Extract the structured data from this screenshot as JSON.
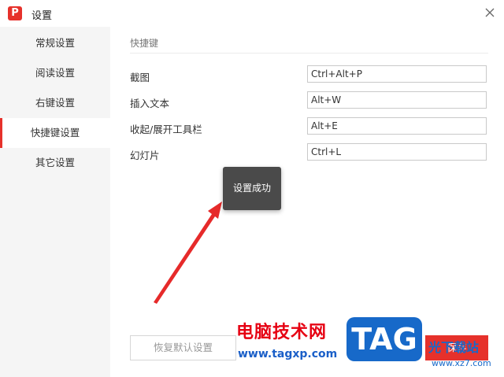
{
  "window": {
    "title": "设置",
    "app_icon_letter": "P"
  },
  "sidebar": {
    "items": [
      {
        "label": "常规设置",
        "active": false
      },
      {
        "label": "阅读设置",
        "active": false
      },
      {
        "label": "右键设置",
        "active": false
      },
      {
        "label": "快捷键设置",
        "active": true
      },
      {
        "label": "其它设置",
        "active": false
      }
    ]
  },
  "main": {
    "section_title": "快捷键",
    "shortcuts": [
      {
        "label": "截图",
        "value": "Ctrl+Alt+P"
      },
      {
        "label": "插入文本",
        "value": "Alt+W"
      },
      {
        "label": "收起/展开工具栏",
        "value": "Alt+E"
      },
      {
        "label": "幻灯片",
        "value": "Ctrl+L"
      }
    ],
    "toast": "设置成功",
    "reset_label": "恢复默认设置",
    "save_label": "保存"
  },
  "watermark": {
    "site_name": "电脑技术网",
    "site_url": "www.tagxp.com",
    "logo_text": "TAG",
    "brand": "光下载站",
    "brand_url": "www.xz7.com"
  },
  "colors": {
    "accent": "#e6312b",
    "sidebar_bg": "#f5f5f5",
    "toast_bg": "#4a4a4a"
  }
}
